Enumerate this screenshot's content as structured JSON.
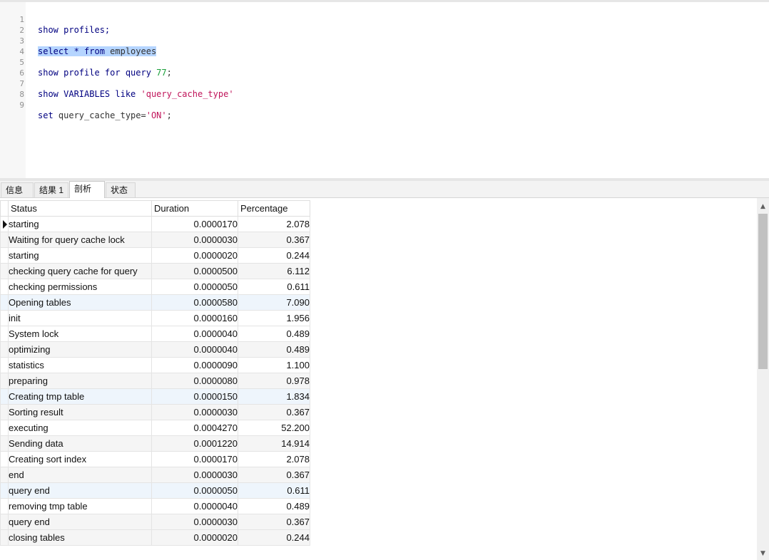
{
  "editor": {
    "line_numbers": [
      "1",
      "2",
      "3",
      "4",
      "5",
      "6",
      "7",
      "8",
      "9"
    ],
    "lines": {
      "l1": "show profiles;",
      "l3_a": "select * from ",
      "l3_b": "employees",
      "l5_a": "show profile for query ",
      "l5_num": "77",
      "l5_c": ";",
      "l7_a": "show VARIABLES like ",
      "l7_str": "'query_cache_type'",
      "l9_a": "set ",
      "l9_b": "query_cache_type=",
      "l9_str": "'ON'",
      "l9_c": ";"
    }
  },
  "tabs": {
    "info": "信息",
    "result1": "结果 1",
    "profile": "剖析",
    "status": "状态"
  },
  "grid": {
    "headers": {
      "status": "Status",
      "duration": "Duration",
      "percentage": "Percentage"
    },
    "rows": [
      {
        "status": "starting",
        "duration": "0.0000170",
        "pct": "2.078"
      },
      {
        "status": "Waiting for query cache lock",
        "duration": "0.0000030",
        "pct": "0.367"
      },
      {
        "status": "starting",
        "duration": "0.0000020",
        "pct": "0.244"
      },
      {
        "status": "checking query cache for query",
        "duration": "0.0000500",
        "pct": "6.112"
      },
      {
        "status": "checking permissions",
        "duration": "0.0000050",
        "pct": "0.611"
      },
      {
        "status": "Opening tables",
        "duration": "0.0000580",
        "pct": "7.090"
      },
      {
        "status": "init",
        "duration": "0.0000160",
        "pct": "1.956"
      },
      {
        "status": "System lock",
        "duration": "0.0000040",
        "pct": "0.489"
      },
      {
        "status": "optimizing",
        "duration": "0.0000040",
        "pct": "0.489"
      },
      {
        "status": "statistics",
        "duration": "0.0000090",
        "pct": "1.100"
      },
      {
        "status": "preparing",
        "duration": "0.0000080",
        "pct": "0.978"
      },
      {
        "status": "Creating tmp table",
        "duration": "0.0000150",
        "pct": "1.834"
      },
      {
        "status": "Sorting result",
        "duration": "0.0000030",
        "pct": "0.367"
      },
      {
        "status": "executing",
        "duration": "0.0004270",
        "pct": "52.200"
      },
      {
        "status": "Sending data",
        "duration": "0.0001220",
        "pct": "14.914"
      },
      {
        "status": "Creating sort index",
        "duration": "0.0000170",
        "pct": "2.078"
      },
      {
        "status": "end",
        "duration": "0.0000030",
        "pct": "0.367"
      },
      {
        "status": "query end",
        "duration": "0.0000050",
        "pct": "0.611"
      },
      {
        "status": "removing tmp table",
        "duration": "0.0000040",
        "pct": "0.489"
      },
      {
        "status": "query end",
        "duration": "0.0000030",
        "pct": "0.367"
      },
      {
        "status": "closing tables",
        "duration": "0.0000020",
        "pct": "0.244"
      }
    ]
  },
  "scrollbar": {
    "up_icon": "▲",
    "down_icon": "▼"
  },
  "colors": {
    "keyword": "#000080",
    "string": "#c0145a",
    "number": "#1a9f3a",
    "selection": "#b5d5ff"
  }
}
